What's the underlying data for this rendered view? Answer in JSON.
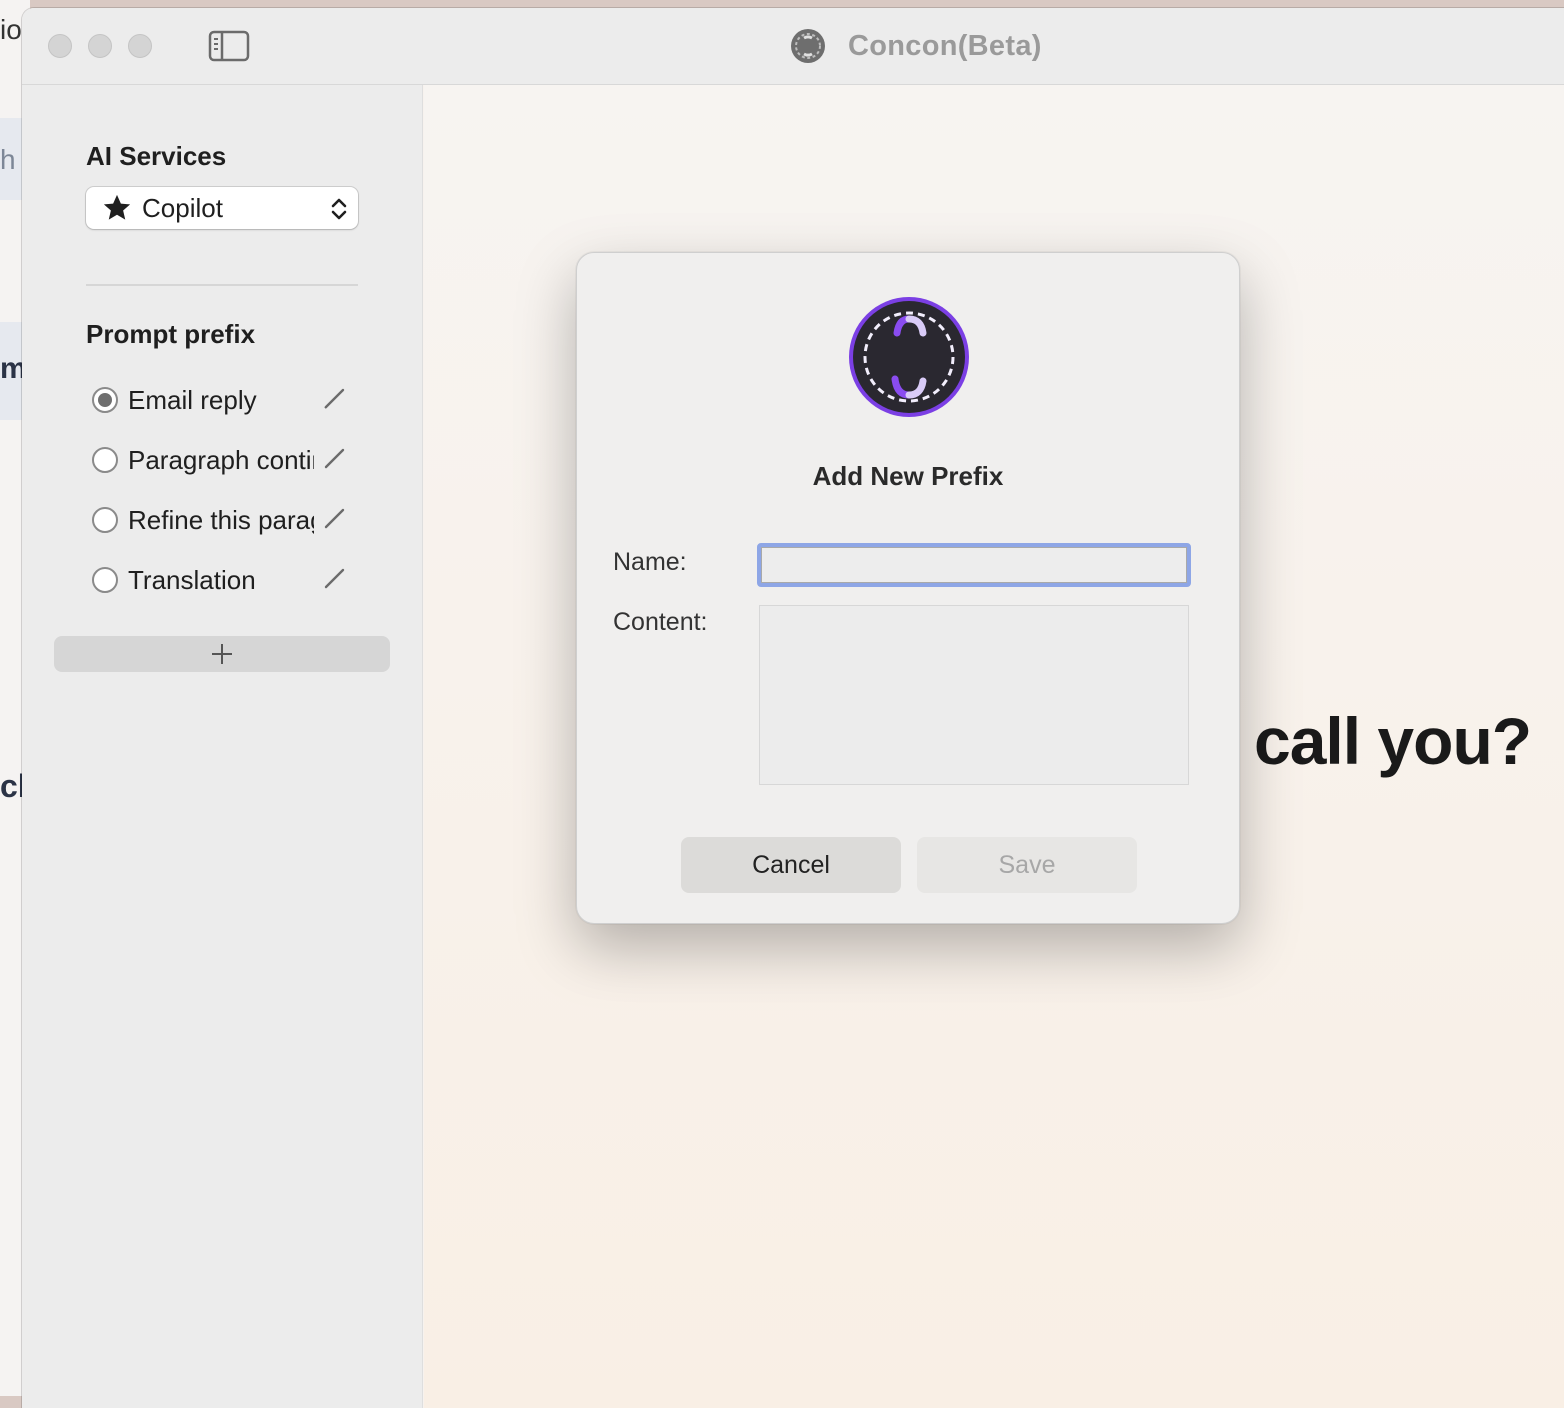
{
  "background_fragments": {
    "top": "io",
    "left1": "h",
    "left2": "m",
    "left3": "ck"
  },
  "window": {
    "title": "Concon(Beta)"
  },
  "sidebar": {
    "ai_services_heading": "AI Services",
    "selected_service": "Copilot",
    "prompt_prefix_heading": "Prompt prefix",
    "prefixes": [
      {
        "label": "Email reply",
        "selected": true
      },
      {
        "label": "Paragraph continuation",
        "selected": false
      },
      {
        "label": "Refine this paragraph",
        "selected": false
      },
      {
        "label": "Translation",
        "selected": false
      }
    ]
  },
  "main": {
    "greeting": "call you?"
  },
  "modal": {
    "title": "Add New Prefix",
    "name_label": "Name:",
    "name_value": "",
    "content_label": "Content:",
    "content_value": "",
    "cancel_label": "Cancel",
    "save_label": "Save"
  },
  "colors": {
    "logo_ring": "#7b3fe4",
    "logo_fill": "#2a2830",
    "focus_ring": "#8ea6e6"
  },
  "icons": {
    "sidebar_toggle": "sidebar-toggle-icon",
    "service": "star-icon",
    "edit": "pencil-icon",
    "add": "plus-icon"
  }
}
